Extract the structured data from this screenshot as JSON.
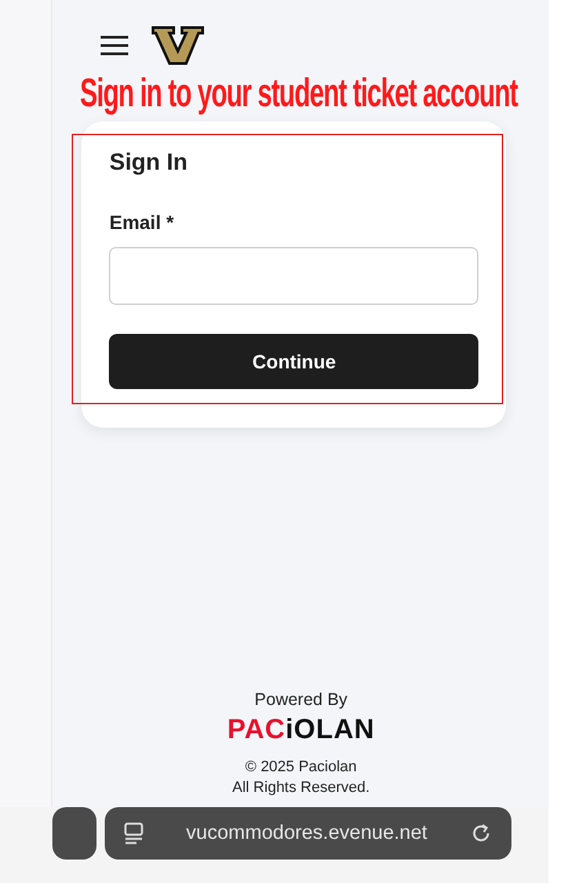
{
  "annotation": "Sign in to your student ticket account",
  "card": {
    "title": "Sign In",
    "email_label": "Email *",
    "button": "Continue"
  },
  "footer": {
    "powered_by": "Powered By",
    "logo": {
      "accent": "PAC",
      "rest": "iOLAN"
    },
    "copyright": "© 2025 Paciolan",
    "rights": "All Rights Reserved."
  },
  "browser": {
    "url": "vucommodores.evenue.net"
  }
}
